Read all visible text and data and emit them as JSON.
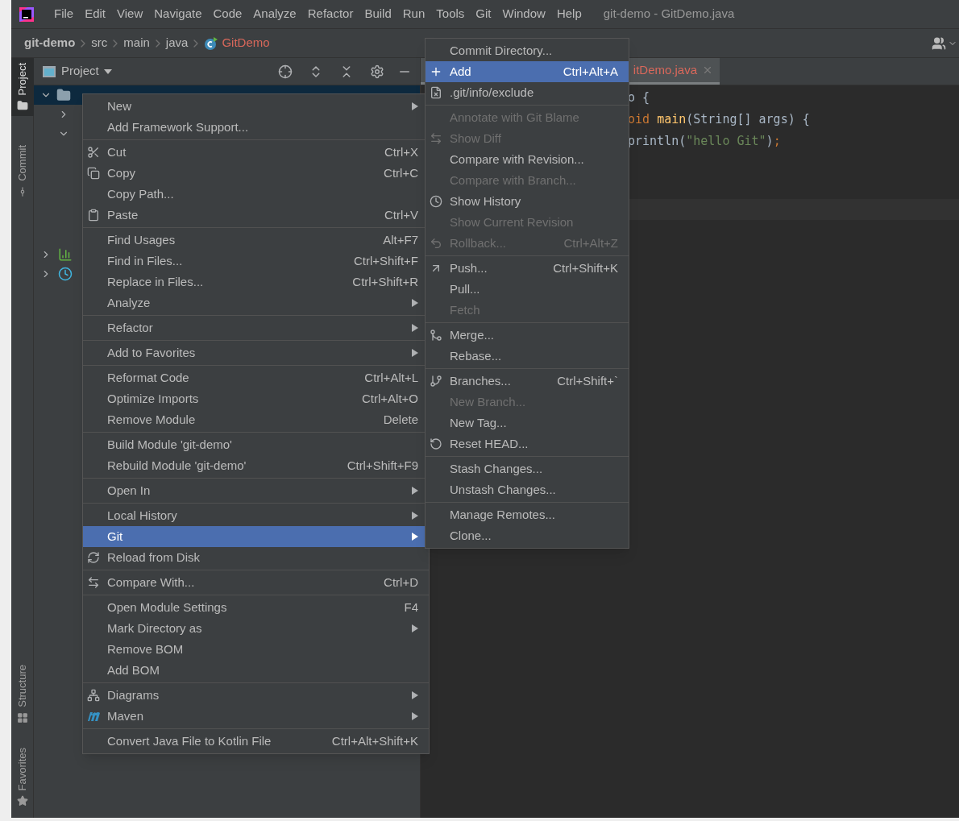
{
  "menu_bar": [
    "File",
    "Edit",
    "View",
    "Navigate",
    "Code",
    "Analyze",
    "Refactor",
    "Build",
    "Run",
    "Tools",
    "Git",
    "Window",
    "Help"
  ],
  "window": {
    "title": "git-demo - GitDemo.java"
  },
  "breadcrumbs": [
    {
      "label": "git-demo",
      "kind": "project"
    },
    {
      "label": "src",
      "kind": "folder"
    },
    {
      "label": "main",
      "kind": "folder"
    },
    {
      "label": "java",
      "kind": "folder"
    },
    {
      "label": "GitDemo",
      "kind": "class"
    }
  ],
  "tool_strip": [
    {
      "label": "Project",
      "selected": true,
      "kind": "project"
    },
    {
      "label": "Commit",
      "selected": false,
      "kind": "commit"
    },
    {
      "label": "Structure",
      "selected": false,
      "kind": "structure"
    },
    {
      "label": "Favorites",
      "selected": false,
      "kind": "favorites"
    }
  ],
  "project_panel": {
    "title": "Project"
  },
  "editor": {
    "tab": "itDemo.java",
    "lines": [
      [
        {
          "kind": "plain",
          "text": "o {"
        }
      ],
      [
        {
          "kind": "keyword",
          "text": "oid "
        },
        {
          "kind": "method",
          "text": "main"
        },
        {
          "kind": "plain",
          "text": "(String[] args) {"
        }
      ],
      [
        {
          "kind": "plain",
          "text": "println("
        },
        {
          "kind": "string",
          "text": "\"hello Git\""
        },
        {
          "kind": "plain",
          "text": ")"
        },
        {
          "kind": "keyword",
          "text": ";"
        }
      ]
    ]
  },
  "context_menu": [
    {
      "kind": "item",
      "label": "New",
      "submenu": true
    },
    {
      "kind": "item",
      "label": "Add Framework Support..."
    },
    {
      "kind": "separator"
    },
    {
      "kind": "item",
      "label": "Cut",
      "shortcut": "Ctrl+X"
    },
    {
      "kind": "item",
      "label": "Copy",
      "shortcut": "Ctrl+C"
    },
    {
      "kind": "item",
      "label": "Copy Path..."
    },
    {
      "kind": "item",
      "label": "Paste",
      "shortcut": "Ctrl+V"
    },
    {
      "kind": "separator"
    },
    {
      "kind": "item",
      "label": "Find Usages",
      "shortcut": "Alt+F7"
    },
    {
      "kind": "item",
      "label": "Find in Files...",
      "shortcut": "Ctrl+Shift+F"
    },
    {
      "kind": "item",
      "label": "Replace in Files...",
      "shortcut": "Ctrl+Shift+R"
    },
    {
      "kind": "item",
      "label": "Analyze",
      "submenu": true
    },
    {
      "kind": "separator"
    },
    {
      "kind": "item",
      "label": "Refactor",
      "submenu": true
    },
    {
      "kind": "separator"
    },
    {
      "kind": "item",
      "label": "Add to Favorites",
      "submenu": true
    },
    {
      "kind": "separator"
    },
    {
      "kind": "item",
      "label": "Reformat Code",
      "shortcut": "Ctrl+Alt+L"
    },
    {
      "kind": "item",
      "label": "Optimize Imports",
      "shortcut": "Ctrl+Alt+O"
    },
    {
      "kind": "item",
      "label": "Remove Module",
      "shortcut": "Delete"
    },
    {
      "kind": "separator"
    },
    {
      "kind": "item",
      "label": "Build Module 'git-demo'"
    },
    {
      "kind": "item",
      "label": "Rebuild Module 'git-demo'",
      "shortcut": "Ctrl+Shift+F9"
    },
    {
      "kind": "separator"
    },
    {
      "kind": "item",
      "label": "Open In",
      "submenu": true
    },
    {
      "kind": "separator"
    },
    {
      "kind": "item",
      "label": "Local History",
      "submenu": true
    },
    {
      "kind": "item",
      "label": "Git",
      "submenu": true,
      "selected": true
    },
    {
      "kind": "item",
      "label": "Reload from Disk"
    },
    {
      "kind": "separator"
    },
    {
      "kind": "item",
      "label": "Compare With...",
      "shortcut": "Ctrl+D"
    },
    {
      "kind": "separator"
    },
    {
      "kind": "item",
      "label": "Open Module Settings",
      "shortcut": "F4"
    },
    {
      "kind": "item",
      "label": "Mark Directory as",
      "submenu": true
    },
    {
      "kind": "item",
      "label": "Remove BOM"
    },
    {
      "kind": "item",
      "label": "Add BOM"
    },
    {
      "kind": "separator"
    },
    {
      "kind": "item",
      "label": "Diagrams",
      "submenu": true
    },
    {
      "kind": "item",
      "label": "Maven",
      "submenu": true
    },
    {
      "kind": "separator"
    },
    {
      "kind": "item",
      "label": "Convert Java File to Kotlin File",
      "shortcut": "Ctrl+Alt+Shift+K"
    }
  ],
  "git_menu": [
    {
      "kind": "item",
      "label": "Commit Directory...",
      "disabled": false,
      "selected": false
    },
    {
      "kind": "item",
      "label": "Add",
      "shortcut": "Ctrl+Alt+A",
      "disabled": false,
      "selected": true
    },
    {
      "kind": "item",
      "label": ".git/info/exclude",
      "disabled": false,
      "selected": false
    },
    {
      "kind": "separator"
    },
    {
      "kind": "item",
      "label": "Annotate with Git Blame",
      "disabled": true,
      "selected": false
    },
    {
      "kind": "item",
      "label": "Show Diff",
      "disabled": true,
      "selected": false
    },
    {
      "kind": "item",
      "label": "Compare with Revision...",
      "disabled": false,
      "selected": false
    },
    {
      "kind": "item",
      "label": "Compare with Branch...",
      "disabled": true,
      "selected": false
    },
    {
      "kind": "item",
      "label": "Show History",
      "disabled": false,
      "selected": false
    },
    {
      "kind": "item",
      "label": "Show Current Revision",
      "disabled": true,
      "selected": false
    },
    {
      "kind": "item",
      "label": "Rollback...",
      "shortcut": "Ctrl+Alt+Z",
      "disabled": true,
      "selected": false
    },
    {
      "kind": "separator"
    },
    {
      "kind": "item",
      "label": "Push...",
      "shortcut": "Ctrl+Shift+K",
      "disabled": false,
      "selected": false
    },
    {
      "kind": "item",
      "label": "Pull...",
      "disabled": false,
      "selected": false
    },
    {
      "kind": "item",
      "label": "Fetch",
      "disabled": true,
      "selected": false
    },
    {
      "kind": "separator"
    },
    {
      "kind": "item",
      "label": "Merge...",
      "disabled": false,
      "selected": false
    },
    {
      "kind": "item",
      "label": "Rebase...",
      "disabled": false,
      "selected": false
    },
    {
      "kind": "separator"
    },
    {
      "kind": "item",
      "label": "Branches...",
      "shortcut": "Ctrl+Shift+`",
      "disabled": false,
      "selected": false
    },
    {
      "kind": "item",
      "label": "New Branch...",
      "disabled": true,
      "selected": false
    },
    {
      "kind": "item",
      "label": "New Tag...",
      "disabled": false,
      "selected": false
    },
    {
      "kind": "item",
      "label": "Reset HEAD...",
      "disabled": false,
      "selected": false
    },
    {
      "kind": "separator"
    },
    {
      "kind": "item",
      "label": "Stash Changes...",
      "disabled": false,
      "selected": false
    },
    {
      "kind": "item",
      "label": "Unstash Changes...",
      "disabled": false,
      "selected": false
    },
    {
      "kind": "separator"
    },
    {
      "kind": "item",
      "label": "Manage Remotes...",
      "disabled": false,
      "selected": false
    },
    {
      "kind": "item",
      "label": "Clone...",
      "disabled": false,
      "selected": false
    }
  ]
}
